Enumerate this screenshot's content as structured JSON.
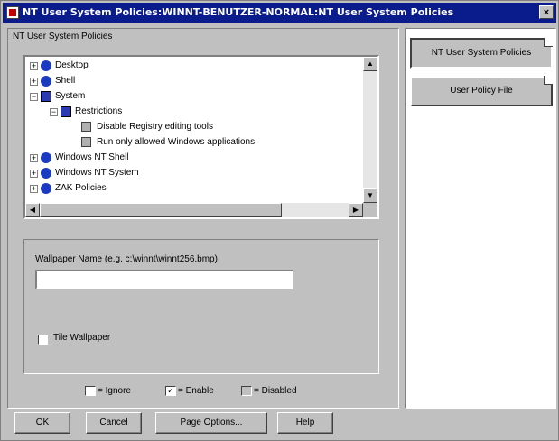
{
  "window": {
    "title": "NT User System Policies:WINNT-BENUTZER-NORMAL:NT User System Policies",
    "close_symbol": "×"
  },
  "panel": {
    "caption": "NT User System Policies"
  },
  "tree": {
    "items": [
      {
        "label": "Desktop",
        "expander": "+",
        "icon": "globe-icon"
      },
      {
        "label": "Shell",
        "expander": "+",
        "icon": "globe-icon"
      },
      {
        "label": "System",
        "expander": "−",
        "icon": "book-icon"
      },
      {
        "label": "Restrictions",
        "expander": "−",
        "icon": "book-icon"
      },
      {
        "label": "Disable Registry editing tools",
        "icon": "checkbox-icon"
      },
      {
        "label": "Run only allowed Windows applications",
        "icon": "checkbox-icon"
      },
      {
        "label": "Windows NT Shell",
        "expander": "+",
        "icon": "globe-icon"
      },
      {
        "label": "Windows NT System",
        "expander": "+",
        "icon": "globe-icon"
      },
      {
        "label": "ZAK Policies",
        "expander": "+",
        "icon": "globe-icon"
      }
    ]
  },
  "settings": {
    "wallpaper_label": "Wallpaper Name (e.g. c:\\winnt\\winnt256.bmp)",
    "wallpaper_value": "",
    "tile_label": "Tile Wallpaper"
  },
  "legend": {
    "ignore": "= Ignore",
    "enable": "= Enable",
    "disabled": "= Disabled",
    "check_mark": "✓"
  },
  "buttons": {
    "ok": "OK",
    "cancel": "Cancel",
    "page_options": "Page Options...",
    "help": "Help"
  },
  "side": {
    "tab1": "NT User System Policies",
    "tab2": "User Policy File"
  },
  "colors": {
    "titlebar": "#0a1c8c",
    "face": "#c0c0c0",
    "globe": "#1a3ac0"
  }
}
